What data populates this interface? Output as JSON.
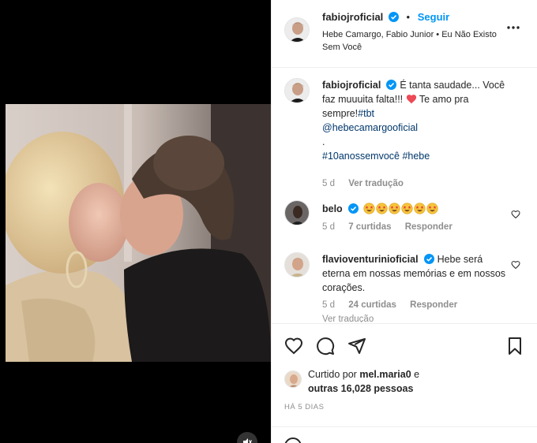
{
  "post": {
    "author": "fabiojroficial",
    "follow_label": "Seguir",
    "dot": "•",
    "audio": "Hebe Camargo, Fabio Junior • Eu Não Existo Sem Você"
  },
  "caption": {
    "author": "fabiojroficial",
    "text_1": "É tanta saudade... Você faz muuuita falta!!!",
    "text_2": "Te amo pra sempre!",
    "hashtag_tbt": "#tbt",
    "mention": "@hebecamargooficial",
    "dot": ".",
    "hashtags": "#10anossemvocê #hebe",
    "time": "5 d",
    "translate": "Ver tradução"
  },
  "comments": [
    {
      "author": "belo",
      "emoji_count": 6,
      "time": "5 d",
      "likes": "7 curtidas",
      "reply": "Responder"
    },
    {
      "author": "flavioventurinioficial",
      "text": "Hebe será eterna em nossas memórias e em nossos corações.",
      "time": "5 d",
      "likes": "24 curtidas",
      "reply": "Responder",
      "translate": "Ver tradução"
    }
  ],
  "likes": {
    "prefix": "Curtido por",
    "user": "mel.maria0",
    "mid": "e",
    "others": "outras 16,028 pessoas"
  },
  "timestamp": "HÁ 5 DIAS",
  "colors": {
    "accent": "#0095f6",
    "verified": "#0095f6",
    "heart": "#ed4956",
    "muted_text": "#8e8e8e"
  },
  "icons": [
    "heart-icon",
    "comment-icon",
    "share-icon",
    "bookmark-icon",
    "more-options-icon",
    "mute-icon",
    "verified-badge-icon"
  ]
}
